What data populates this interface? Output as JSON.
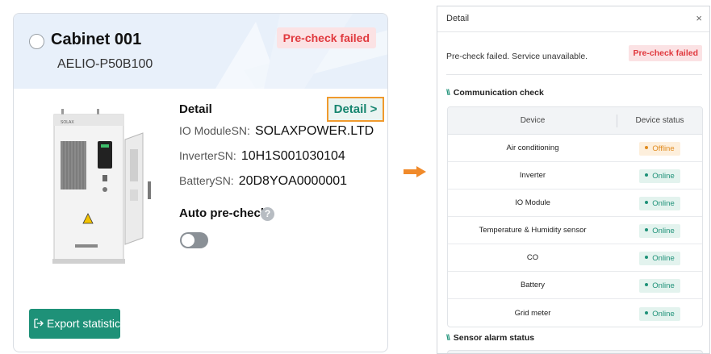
{
  "card": {
    "title": "Cabinet 001",
    "model": "AELIO-P50B100",
    "status_badge": "Pre-check failed",
    "detail_heading": "Detail",
    "detail_link": "Detail >",
    "io_module_label": "IO ModuleSN:",
    "io_module_value": "SOLAXPOWER.LTD",
    "inverter_label": "InverterSN:",
    "inverter_value": "10H1S001030104",
    "battery_label": "BatterySN:",
    "battery_value": "20D8YOA0000001",
    "auto_precheck_label": "Auto pre-check",
    "help_icon": "?",
    "export_button": "Export statistics",
    "cabinet_brand": "SOLAX"
  },
  "panel": {
    "title": "Detail",
    "close": "×",
    "message": "Pre-check failed. Service unavailable.",
    "status_badge": "Pre-check failed",
    "communication_title": "Communication check",
    "sensor_title": "Sensor alarm status",
    "table": {
      "headers": [
        "Device",
        "Device status"
      ],
      "rows": [
        {
          "device": "Air conditioning",
          "status": "Offline"
        },
        {
          "device": "Inverter",
          "status": "Online"
        },
        {
          "device": "IO Module",
          "status": "Online"
        },
        {
          "device": "Temperature & Humidity sensor",
          "status": "Online"
        },
        {
          "device": "CO",
          "status": "Online"
        },
        {
          "device": "Battery",
          "status": "Online"
        },
        {
          "device": "Grid meter",
          "status": "Online"
        }
      ]
    }
  },
  "colors": {
    "accent": "#1e9178",
    "fail_red": "#e0393e",
    "highlight_orange": "#f09a2d",
    "offline_orange": "#e08a1e"
  },
  "icons": {
    "arrow": "right-arrow-icon",
    "export": "export-icon",
    "radio": "radio-icon",
    "help": "question-icon",
    "close": "close-icon"
  }
}
